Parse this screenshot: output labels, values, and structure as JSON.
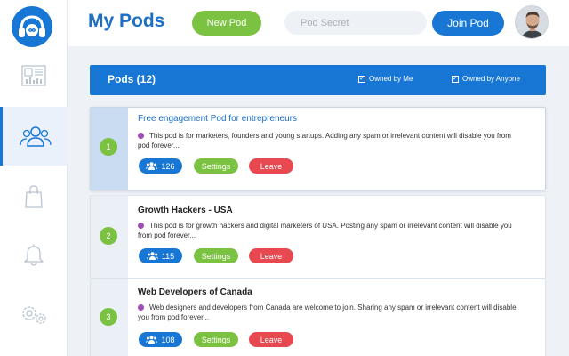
{
  "header": {
    "title": "My Pods",
    "new_pod_label": "New Pod",
    "secret_placeholder": "Pod Secret",
    "secret_value": "",
    "join_pod_label": "Join Pod"
  },
  "sidebar": {
    "items": [
      {
        "name": "dashboard",
        "icon": "dashboard-icon",
        "active": false
      },
      {
        "name": "pods",
        "icon": "users-icon",
        "active": true
      },
      {
        "name": "shop",
        "icon": "shopping-bag-icon",
        "active": false
      },
      {
        "name": "notifications",
        "icon": "bell-icon",
        "active": false
      },
      {
        "name": "settings",
        "icon": "gears-icon",
        "active": false
      }
    ]
  },
  "pods_bar": {
    "title": "Pods (12)",
    "filter_owned_by_me": "Owned by Me",
    "filter_owned_by_anyone": "Owned by Anyone"
  },
  "pods": [
    {
      "number": "1",
      "name": "Free engagement Pod for entrepreneurs",
      "description": "This pod is for marketers, founders and young startups. Adding any spam or irrelevant content will disable you from pod forever...",
      "members": "126",
      "settings_label": "Settings",
      "leave_label": "Leave"
    },
    {
      "number": "2",
      "name": "Growth Hackers - USA",
      "description": "This pod is for growth hackers and digital marketers of USA. Posting any spam or irrelevant content will disable you from pod forever...",
      "members": "115",
      "settings_label": "Settings",
      "leave_label": "Leave"
    },
    {
      "number": "3",
      "name": "Web Developers of Canada",
      "description": "Web designers and developers from Canada are welcome to join. Sharing any spam or irrelevant content will disable you from pod forever...",
      "members": "108",
      "settings_label": "Settings",
      "leave_label": "Leave"
    }
  ],
  "colors": {
    "primary": "#1877d4",
    "success": "#7cc242",
    "danger": "#e8484f",
    "dot": "#a04fb6"
  }
}
